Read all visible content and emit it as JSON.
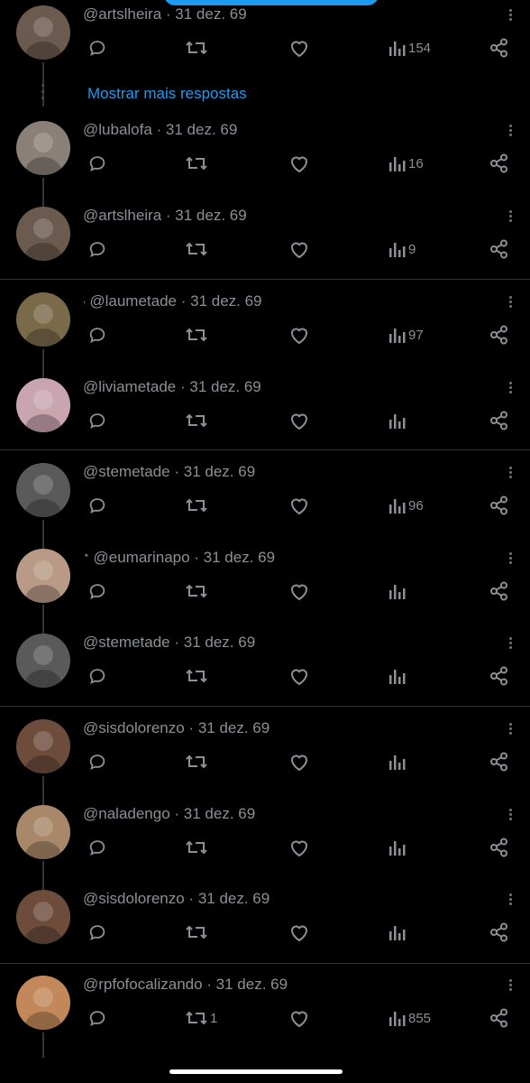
{
  "show_more_replies": "Mostrar mais respostas",
  "posts": [
    {
      "prefix": "",
      "handle": "@artslheira",
      "date": "31 dez. 69",
      "views": "154",
      "retweets": "",
      "avatar": "#6b5a4e"
    },
    {
      "prefix": "",
      "handle": "@lubalofa",
      "date": "31 dez. 69",
      "views": "16",
      "retweets": "",
      "avatar": "#8a8078"
    },
    {
      "prefix": "",
      "handle": "@artslheira",
      "date": "31 dez. 69",
      "views": "9",
      "retweets": "",
      "avatar": "#6b5a4e"
    },
    {
      "prefix": ",",
      "handle": "@laumetade",
      "date": "31 dez. 69",
      "views": "97",
      "retweets": "",
      "avatar": "#7a6a4a"
    },
    {
      "prefix": "",
      "handle": "@liviametade",
      "date": "31 dez. 69",
      "views": "",
      "retweets": "",
      "avatar": "#c9a5b0"
    },
    {
      "prefix": "",
      "handle": "@stemetade",
      "date": "31 dez. 69",
      "views": "96",
      "retweets": "",
      "avatar": "#5a5a5a"
    },
    {
      "prefix": "⋆",
      "handle": "@eumarinapo",
      "date": "31 dez. 69",
      "views": "",
      "retweets": "",
      "avatar": "#b89a86"
    },
    {
      "prefix": "",
      "handle": "@stemetade",
      "date": "31 dez. 69",
      "views": "",
      "retweets": "",
      "avatar": "#5a5a5a"
    },
    {
      "prefix": "",
      "handle": "@sisdolorenzo",
      "date": "31 dez. 69",
      "views": "",
      "retweets": "",
      "avatar": "#6e4c3c"
    },
    {
      "prefix": "",
      "handle": "@naladengo",
      "date": "31 dez. 69",
      "views": "",
      "retweets": "",
      "avatar": "#a88868"
    },
    {
      "prefix": "",
      "handle": "@sisdolorenzo",
      "date": "31 dez. 69",
      "views": "",
      "retweets": "",
      "avatar": "#6e4c3c"
    },
    {
      "prefix": "",
      "handle": "@rpfofocalizando",
      "date": "31 dez. 69",
      "views": "855",
      "retweets": "1",
      "avatar": "#c2885a"
    }
  ],
  "colors": {
    "accent": "#1d9bf0",
    "background": "#000000",
    "text_muted": "#71767b"
  },
  "icons": [
    "reply-icon",
    "retweet-icon",
    "like-icon",
    "views-icon",
    "share-icon",
    "more-icon"
  ]
}
